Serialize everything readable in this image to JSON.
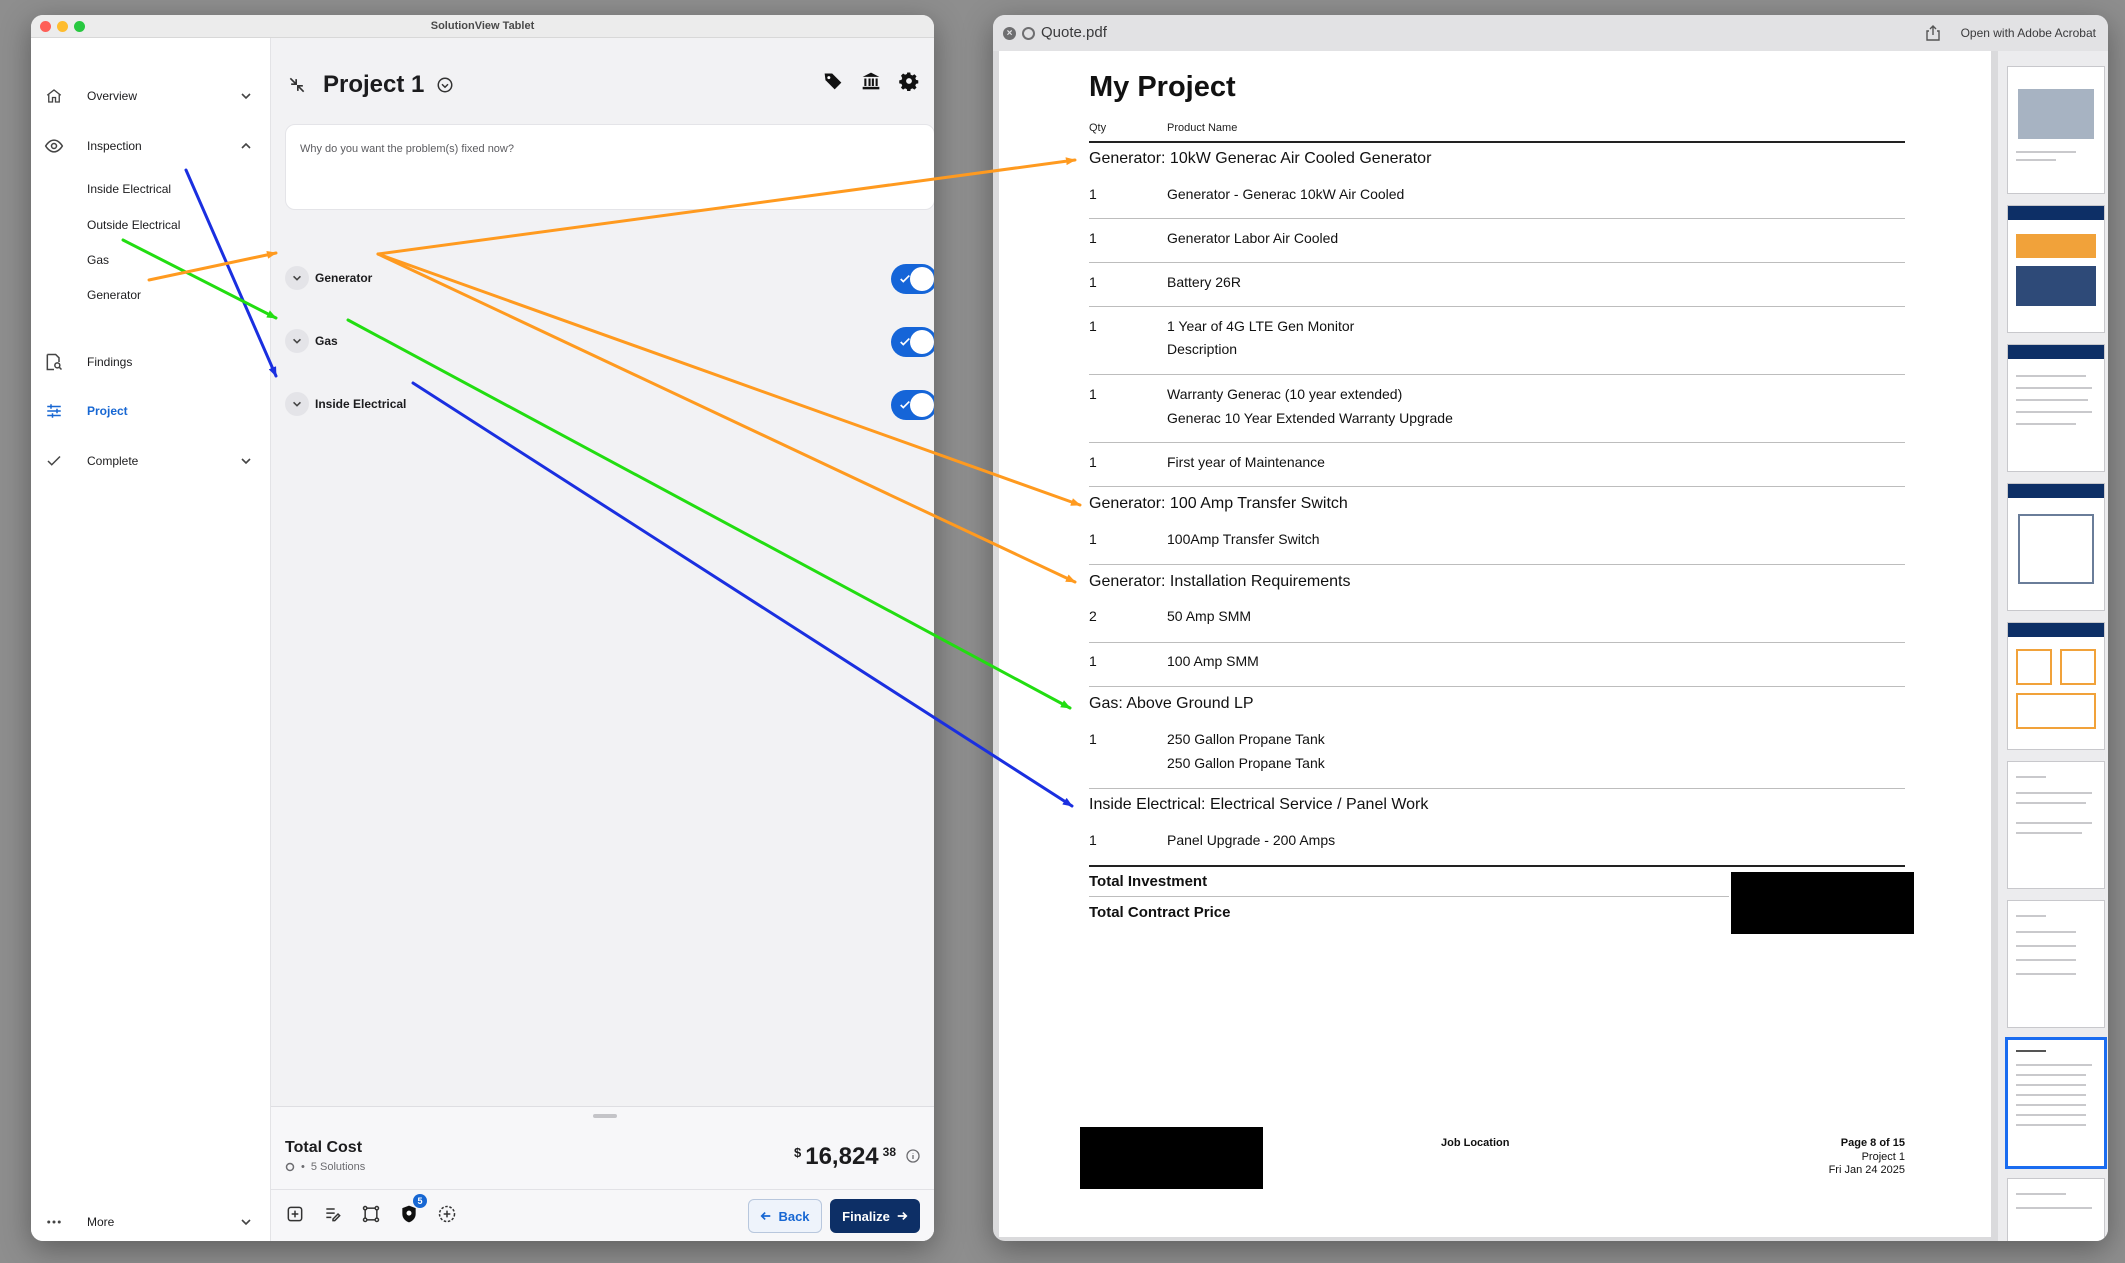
{
  "app": {
    "window_title": "SolutionView Tablet",
    "nav": {
      "overview": "Overview",
      "inspection": "Inspection",
      "findings": "Findings",
      "project": "Project",
      "complete": "Complete",
      "more": "More"
    },
    "inspection_items": [
      "Inside Electrical",
      "Outside Electrical",
      "Gas",
      "Generator"
    ],
    "project_title": "Project 1",
    "question_placeholder": "Why do you want the problem(s) fixed now?",
    "solutions": [
      {
        "name": "Generator",
        "enabled": true
      },
      {
        "name": "Gas",
        "enabled": true
      },
      {
        "name": "Inside Electrical",
        "enabled": true
      }
    ],
    "total_cost_label": "Total Cost",
    "solutions_count": "5 Solutions",
    "price_symbol": "$",
    "price_main": "16,824",
    "price_cents": "38",
    "badge_count": "5",
    "back_label": "Back",
    "finalize_label": "Finalize",
    "accent_color": "#1767d3",
    "finalize_color": "#0d2f66"
  },
  "pdf": {
    "filename": "Quote.pdf",
    "open_with": "Open with Adobe Acrobat",
    "heading": "My Project",
    "col_qty": "Qty",
    "col_product": "Product Name",
    "sections": {
      "gen1": "Generator:  10kW Generac Air Cooled Generator",
      "gen2": "Generator: 100 Amp Transfer Switch",
      "gen3": "Generator: Installation Requirements",
      "gas": "Gas: Above Ground LP",
      "elec": "Inside Electrical: Electrical Service / Panel Work"
    },
    "items": {
      "i1": {
        "qty": "1",
        "name": "Generator - Generac 10kW Air Cooled"
      },
      "i2": {
        "qty": "1",
        "name": "Generator Labor Air Cooled"
      },
      "i3": {
        "qty": "1",
        "name": "Battery 26R"
      },
      "i4": {
        "qty": "1",
        "name": "1 Year of 4G LTE Gen Monitor",
        "desc": "Description"
      },
      "i5": {
        "qty": "1",
        "name": "Warranty Generac (10 year extended)",
        "desc": "Generac 10 Year Extended Warranty Upgrade"
      },
      "i6": {
        "qty": "1",
        "name": "First year of Maintenance"
      },
      "i7": {
        "qty": "1",
        "name": "100Amp Transfer Switch"
      },
      "i8": {
        "qty": "2",
        "name": "50 Amp SMM"
      },
      "i9": {
        "qty": "1",
        "name": "100 Amp SMM"
      },
      "i10": {
        "qty": "1",
        "name": "250 Gallon Propane Tank",
        "desc": "250 Gallon Propane Tank"
      },
      "i11": {
        "qty": "1",
        "name": "Panel Upgrade - 200 Amps"
      }
    },
    "total_investment": "Total Investment",
    "total_contract": "Total Contract Price",
    "footer": {
      "job_location": "Job Location",
      "page": "Page 8 of 15",
      "project": "Project 1",
      "date": "Fri Jan 24 2025"
    },
    "thumb_count": 9,
    "selected_thumb": 8
  },
  "annotations": {
    "generator_arrow_color": "#ff9a1f",
    "gas_arrow_color": "#22dd11",
    "electrical_arrow_color": "#1a2fe0"
  }
}
